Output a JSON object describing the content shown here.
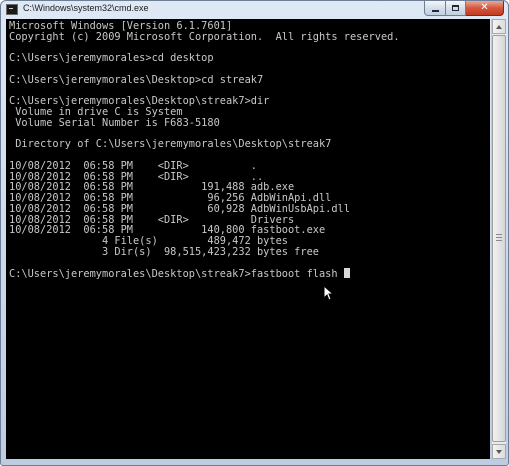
{
  "window": {
    "title": "C:\\Windows\\system32\\cmd.exe",
    "buttons": {
      "minimize_icon": "minimize-icon",
      "maximize_icon": "maximize-icon",
      "close_icon": "close-icon",
      "close_glyph": "✕"
    }
  },
  "console": {
    "lines": [
      "Microsoft Windows [Version 6.1.7601]",
      "Copyright (c) 2009 Microsoft Corporation.  All rights reserved.",
      "",
      "C:\\Users\\jeremymorales>cd desktop",
      "",
      "C:\\Users\\jeremymorales\\Desktop>cd streak7",
      "",
      "C:\\Users\\jeremymorales\\Desktop\\streak7>dir",
      " Volume in drive C is System",
      " Volume Serial Number is F683-5180",
      "",
      " Directory of C:\\Users\\jeremymorales\\Desktop\\streak7",
      "",
      "10/08/2012  06:58 PM    <DIR>          .",
      "10/08/2012  06:58 PM    <DIR>          ..",
      "10/08/2012  06:58 PM           191,488 adb.exe",
      "10/08/2012  06:58 PM            96,256 AdbWinApi.dll",
      "10/08/2012  06:58 PM            60,928 AdbWinUsbApi.dll",
      "10/08/2012  06:58 PM    <DIR>          Drivers",
      "10/08/2012  06:58 PM           140,800 fastboot.exe",
      "               4 File(s)        489,472 bytes",
      "               3 Dir(s)  98,515,423,232 bytes free",
      ""
    ],
    "prompt": "C:\\Users\\jeremymorales\\Desktop\\streak7>",
    "current_input": "fastboot flash"
  },
  "colors": {
    "console_background": "#000000",
    "console_text": "#c8c8c8",
    "close_button": "#c7432a"
  }
}
